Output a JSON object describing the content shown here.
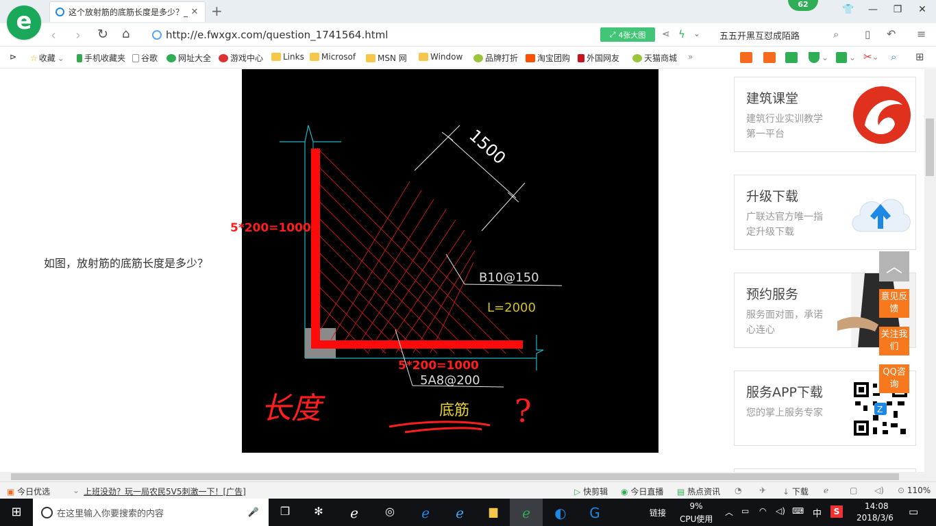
{
  "browser": {
    "tab_title": "这个放射筋的底筋长度是多少？_",
    "badge_count": "62",
    "url": "http://e.fwxgx.com/question_1741564.html",
    "big_image_label": "4张大图",
    "search_text": "五五开黑互怼成陌路"
  },
  "bookmarks": [
    "收藏",
    "手机收藏夹",
    "谷歌",
    "网址大全",
    "游戏中心",
    "Links",
    "Microsof",
    "MSN 网",
    "Window",
    "品牌打折",
    "淘宝团购",
    "外国网友",
    "天猫商城"
  ],
  "page": {
    "question_text": "如图，放射筋的底筋长度是多少？",
    "diagram": {
      "dim_top": "1500",
      "label_left": "5*200=1000",
      "label_bottom": "5*200=1000",
      "label_b10": "B10@150",
      "label_l": "L=2000",
      "label_5a8": "5A8@200",
      "label_dijin": "底筋",
      "handwriting_changdu": "长度",
      "handwriting_q": "?"
    },
    "cards": [
      {
        "title": "建筑课堂",
        "subtitle": "建筑行业实训教学第一平台"
      },
      {
        "title": "升级下载",
        "subtitle": "广联达官方唯一指定升级下载"
      },
      {
        "title": "预约服务",
        "subtitle": "服务面对面，承诺心连心"
      },
      {
        "title": "服务APP下载",
        "subtitle": "您的掌上服务专家"
      }
    ],
    "float_buttons": [
      "意见反馈",
      "关注我们",
      "QQ咨询"
    ]
  },
  "statusbar": {
    "today_pick": "今日优选",
    "ad_text": "上班没劲？玩一局农民5V5刺激一下！[广告]",
    "items": [
      "快剪辑",
      "今日直播",
      "热点资讯",
      "下载"
    ],
    "zoom": "110%"
  },
  "taskbar": {
    "search_placeholder": "在这里输入你要搜索的内容",
    "link_label": "链接",
    "cpu_percent": "9%",
    "cpu_label": "CPU使用",
    "ime": "中",
    "time": "14:08",
    "date": "2018/3/6"
  }
}
